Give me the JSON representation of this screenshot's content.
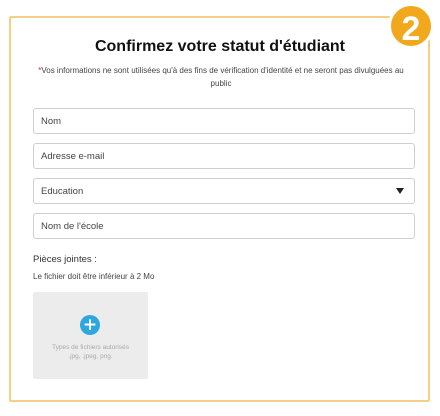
{
  "step": {
    "number": "2"
  },
  "form": {
    "title": "Confirmez votre statut d'étudiant",
    "disclaimer_asterisk": "*",
    "disclaimer": "Vos informations ne sont utilisées qu'à des fins de vérification d'identité et ne seront pas divulguées au public",
    "fields": {
      "name_placeholder": "Nom",
      "email_placeholder": "Adresse e-mail",
      "education_selected": "Education",
      "school_placeholder": "Nom de l'école"
    },
    "attachments": {
      "label": "Pièces jointes :",
      "size_note": "Le fichier doit être inférieur à 2 Mo",
      "upload_plus": "+",
      "allowed_types_line1": "Types de fichiers autorisés",
      "allowed_types_line2": ".jpg, .jpeg, png."
    }
  },
  "colors": {
    "badge": "#f2a81d",
    "card_border": "#f6cf86",
    "upload_plus": "#2ea7e0",
    "asterisk": "#d02a2a"
  },
  "icons": {
    "dropdown": "chevron-down-icon",
    "upload": "plus-circle-icon"
  }
}
